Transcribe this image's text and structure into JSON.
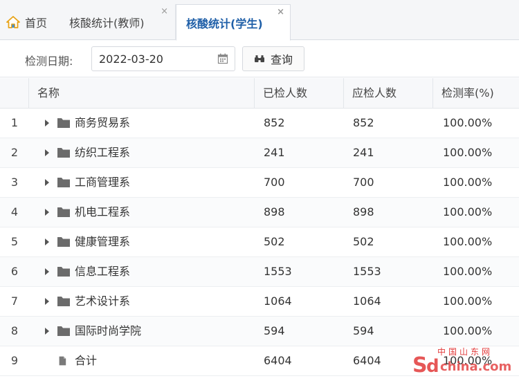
{
  "tabs": {
    "home": {
      "label": "首页"
    },
    "teacher": {
      "label": "核酸统计(教师)",
      "close": "×"
    },
    "student": {
      "label": "核酸统计(学生)",
      "close": "×"
    }
  },
  "search": {
    "date_label": "检测日期:",
    "date_value": "2022-03-20",
    "query_label": "查询"
  },
  "table": {
    "columns": [
      "名称",
      "已检人数",
      "应检人数",
      "检测率(%)"
    ],
    "rows": [
      {
        "idx": "1",
        "name": "商务贸易系",
        "done": "852",
        "should": "852",
        "rate": "100.00%"
      },
      {
        "idx": "2",
        "name": "纺织工程系",
        "done": "241",
        "should": "241",
        "rate": "100.00%"
      },
      {
        "idx": "3",
        "name": "工商管理系",
        "done": "700",
        "should": "700",
        "rate": "100.00%"
      },
      {
        "idx": "4",
        "name": "机电工程系",
        "done": "898",
        "should": "898",
        "rate": "100.00%"
      },
      {
        "idx": "5",
        "name": "健康管理系",
        "done": "502",
        "should": "502",
        "rate": "100.00%"
      },
      {
        "idx": "6",
        "name": "信息工程系",
        "done": "1553",
        "should": "1553",
        "rate": "100.00%"
      },
      {
        "idx": "7",
        "name": "艺术设计系",
        "done": "1064",
        "should": "1064",
        "rate": "100.00%"
      },
      {
        "idx": "8",
        "name": "国际时尚学院",
        "done": "594",
        "should": "594",
        "rate": "100.00%"
      },
      {
        "idx": "9",
        "name": "合计",
        "done": "6404",
        "should": "6404",
        "rate": "100.00%"
      }
    ]
  },
  "watermark": {
    "top": "中国山东网",
    "logo": "sdchina.com"
  },
  "colors": {
    "accent": "#1f5fa8",
    "home_icon": "#e8a317",
    "watermark": "#e23a3a"
  }
}
